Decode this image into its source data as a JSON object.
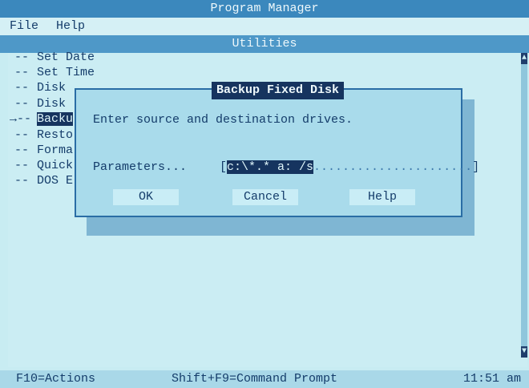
{
  "app": {
    "title": "Program Manager"
  },
  "menu": {
    "file": "File",
    "help": "Help"
  },
  "group": {
    "title": "Utilities"
  },
  "scrollbar": {
    "up_icon": "up-arrow",
    "down_icon": "down-arrow"
  },
  "programs": [
    {
      "marker": "--",
      "label": "Set Date"
    },
    {
      "marker": "--",
      "label": "Set Time"
    },
    {
      "marker": "--",
      "label": "Disk"
    },
    {
      "marker": "--",
      "label": "Disk"
    },
    {
      "marker": "→--",
      "label": "Backu"
    },
    {
      "marker": "--",
      "label": "Resto"
    },
    {
      "marker": "--",
      "label": "Forma"
    },
    {
      "marker": "--",
      "label": "Quick"
    },
    {
      "marker": "--",
      "label": "DOS E"
    }
  ],
  "dialog": {
    "title": "Backup Fixed Disk",
    "instruction": "Enter source and destination drives.",
    "param_label": "Parameters...",
    "param_open": "[",
    "param_value": "c:\\*.* a: /s",
    "param_fill": "......................",
    "param_close": "]",
    "buttons": {
      "ok": "OK",
      "cancel": "Cancel",
      "help": "Help"
    }
  },
  "status": {
    "actions": "F10=Actions",
    "prompt": "Shift+F9=Command Prompt",
    "time": "11:51 am"
  },
  "colors": {
    "background": "#c8ecf2",
    "title_bar": "#3b88bd",
    "selection": "#16345f",
    "text": "#143c6a"
  }
}
